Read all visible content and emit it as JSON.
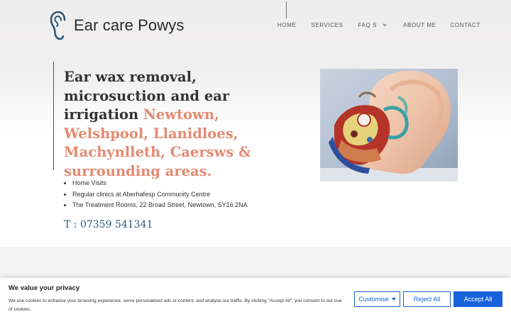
{
  "header": {
    "site_name": "Ear care Powys",
    "nav": [
      {
        "label": "HOME"
      },
      {
        "label": "SERVICES"
      },
      {
        "label": "FAQ S",
        "has_dropdown": true
      },
      {
        "label": "ABOUT ME"
      },
      {
        "label": "CONTACT"
      }
    ]
  },
  "hero": {
    "headline_plain": "Ear wax removal, microsuction and ear irrigation ",
    "headline_accent": "Newtown, Welshpool, Llanidloes, Machynlleth, Caersws & surrounding areas.",
    "bullets": [
      "Home Visits",
      "Regular clinics at Aberhafesp Community Centre",
      "The Treatment Rooms, 22 Broad Street, Newtown, SY16 2NA"
    ],
    "phone": "T : 07359 541341"
  },
  "cookie": {
    "title": "We value your privacy",
    "text": "We use cookies to enhance your browsing experience, serve personalised ads or content, and analyse our traffic. By clicking \"Accept All\", you consent to our use of cookies.",
    "customise_label": "Customise",
    "reject_label": "Reject All",
    "accept_label": "Accept All"
  },
  "colors": {
    "accent": "#e48a72",
    "phone": "#2c5a78",
    "cookie_button": "#1863dc"
  }
}
